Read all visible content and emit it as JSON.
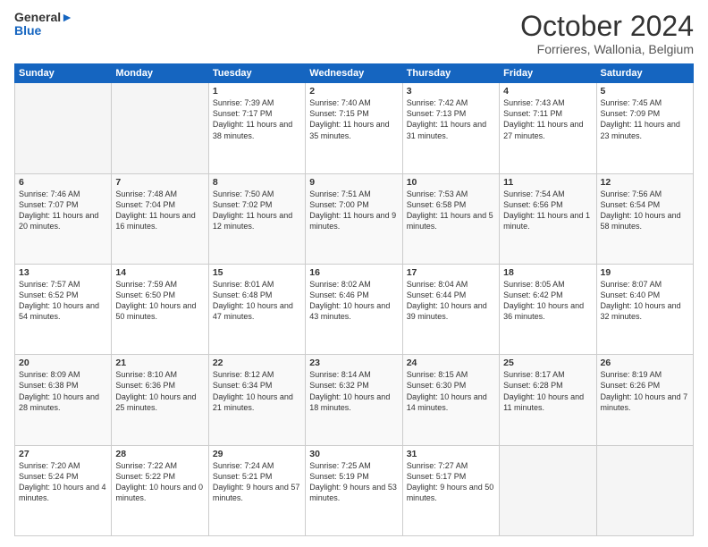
{
  "header": {
    "logo_line1": "General",
    "logo_line2": "Blue",
    "month_title": "October 2024",
    "location": "Forrieres, Wallonia, Belgium"
  },
  "weekdays": [
    "Sunday",
    "Monday",
    "Tuesday",
    "Wednesday",
    "Thursday",
    "Friday",
    "Saturday"
  ],
  "weeks": [
    [
      {
        "day": "",
        "sunrise": "",
        "sunset": "",
        "daylight": ""
      },
      {
        "day": "",
        "sunrise": "",
        "sunset": "",
        "daylight": ""
      },
      {
        "day": "1",
        "sunrise": "Sunrise: 7:39 AM",
        "sunset": "Sunset: 7:17 PM",
        "daylight": "Daylight: 11 hours and 38 minutes."
      },
      {
        "day": "2",
        "sunrise": "Sunrise: 7:40 AM",
        "sunset": "Sunset: 7:15 PM",
        "daylight": "Daylight: 11 hours and 35 minutes."
      },
      {
        "day": "3",
        "sunrise": "Sunrise: 7:42 AM",
        "sunset": "Sunset: 7:13 PM",
        "daylight": "Daylight: 11 hours and 31 minutes."
      },
      {
        "day": "4",
        "sunrise": "Sunrise: 7:43 AM",
        "sunset": "Sunset: 7:11 PM",
        "daylight": "Daylight: 11 hours and 27 minutes."
      },
      {
        "day": "5",
        "sunrise": "Sunrise: 7:45 AM",
        "sunset": "Sunset: 7:09 PM",
        "daylight": "Daylight: 11 hours and 23 minutes."
      }
    ],
    [
      {
        "day": "6",
        "sunrise": "Sunrise: 7:46 AM",
        "sunset": "Sunset: 7:07 PM",
        "daylight": "Daylight: 11 hours and 20 minutes."
      },
      {
        "day": "7",
        "sunrise": "Sunrise: 7:48 AM",
        "sunset": "Sunset: 7:04 PM",
        "daylight": "Daylight: 11 hours and 16 minutes."
      },
      {
        "day": "8",
        "sunrise": "Sunrise: 7:50 AM",
        "sunset": "Sunset: 7:02 PM",
        "daylight": "Daylight: 11 hours and 12 minutes."
      },
      {
        "day": "9",
        "sunrise": "Sunrise: 7:51 AM",
        "sunset": "Sunset: 7:00 PM",
        "daylight": "Daylight: 11 hours and 9 minutes."
      },
      {
        "day": "10",
        "sunrise": "Sunrise: 7:53 AM",
        "sunset": "Sunset: 6:58 PM",
        "daylight": "Daylight: 11 hours and 5 minutes."
      },
      {
        "day": "11",
        "sunrise": "Sunrise: 7:54 AM",
        "sunset": "Sunset: 6:56 PM",
        "daylight": "Daylight: 11 hours and 1 minute."
      },
      {
        "day": "12",
        "sunrise": "Sunrise: 7:56 AM",
        "sunset": "Sunset: 6:54 PM",
        "daylight": "Daylight: 10 hours and 58 minutes."
      }
    ],
    [
      {
        "day": "13",
        "sunrise": "Sunrise: 7:57 AM",
        "sunset": "Sunset: 6:52 PM",
        "daylight": "Daylight: 10 hours and 54 minutes."
      },
      {
        "day": "14",
        "sunrise": "Sunrise: 7:59 AM",
        "sunset": "Sunset: 6:50 PM",
        "daylight": "Daylight: 10 hours and 50 minutes."
      },
      {
        "day": "15",
        "sunrise": "Sunrise: 8:01 AM",
        "sunset": "Sunset: 6:48 PM",
        "daylight": "Daylight: 10 hours and 47 minutes."
      },
      {
        "day": "16",
        "sunrise": "Sunrise: 8:02 AM",
        "sunset": "Sunset: 6:46 PM",
        "daylight": "Daylight: 10 hours and 43 minutes."
      },
      {
        "day": "17",
        "sunrise": "Sunrise: 8:04 AM",
        "sunset": "Sunset: 6:44 PM",
        "daylight": "Daylight: 10 hours and 39 minutes."
      },
      {
        "day": "18",
        "sunrise": "Sunrise: 8:05 AM",
        "sunset": "Sunset: 6:42 PM",
        "daylight": "Daylight: 10 hours and 36 minutes."
      },
      {
        "day": "19",
        "sunrise": "Sunrise: 8:07 AM",
        "sunset": "Sunset: 6:40 PM",
        "daylight": "Daylight: 10 hours and 32 minutes."
      }
    ],
    [
      {
        "day": "20",
        "sunrise": "Sunrise: 8:09 AM",
        "sunset": "Sunset: 6:38 PM",
        "daylight": "Daylight: 10 hours and 28 minutes."
      },
      {
        "day": "21",
        "sunrise": "Sunrise: 8:10 AM",
        "sunset": "Sunset: 6:36 PM",
        "daylight": "Daylight: 10 hours and 25 minutes."
      },
      {
        "day": "22",
        "sunrise": "Sunrise: 8:12 AM",
        "sunset": "Sunset: 6:34 PM",
        "daylight": "Daylight: 10 hours and 21 minutes."
      },
      {
        "day": "23",
        "sunrise": "Sunrise: 8:14 AM",
        "sunset": "Sunset: 6:32 PM",
        "daylight": "Daylight: 10 hours and 18 minutes."
      },
      {
        "day": "24",
        "sunrise": "Sunrise: 8:15 AM",
        "sunset": "Sunset: 6:30 PM",
        "daylight": "Daylight: 10 hours and 14 minutes."
      },
      {
        "day": "25",
        "sunrise": "Sunrise: 8:17 AM",
        "sunset": "Sunset: 6:28 PM",
        "daylight": "Daylight: 10 hours and 11 minutes."
      },
      {
        "day": "26",
        "sunrise": "Sunrise: 8:19 AM",
        "sunset": "Sunset: 6:26 PM",
        "daylight": "Daylight: 10 hours and 7 minutes."
      }
    ],
    [
      {
        "day": "27",
        "sunrise": "Sunrise: 7:20 AM",
        "sunset": "Sunset: 5:24 PM",
        "daylight": "Daylight: 10 hours and 4 minutes."
      },
      {
        "day": "28",
        "sunrise": "Sunrise: 7:22 AM",
        "sunset": "Sunset: 5:22 PM",
        "daylight": "Daylight: 10 hours and 0 minutes."
      },
      {
        "day": "29",
        "sunrise": "Sunrise: 7:24 AM",
        "sunset": "Sunset: 5:21 PM",
        "daylight": "Daylight: 9 hours and 57 minutes."
      },
      {
        "day": "30",
        "sunrise": "Sunrise: 7:25 AM",
        "sunset": "Sunset: 5:19 PM",
        "daylight": "Daylight: 9 hours and 53 minutes."
      },
      {
        "day": "31",
        "sunrise": "Sunrise: 7:27 AM",
        "sunset": "Sunset: 5:17 PM",
        "daylight": "Daylight: 9 hours and 50 minutes."
      },
      {
        "day": "",
        "sunrise": "",
        "sunset": "",
        "daylight": ""
      },
      {
        "day": "",
        "sunrise": "",
        "sunset": "",
        "daylight": ""
      }
    ]
  ]
}
